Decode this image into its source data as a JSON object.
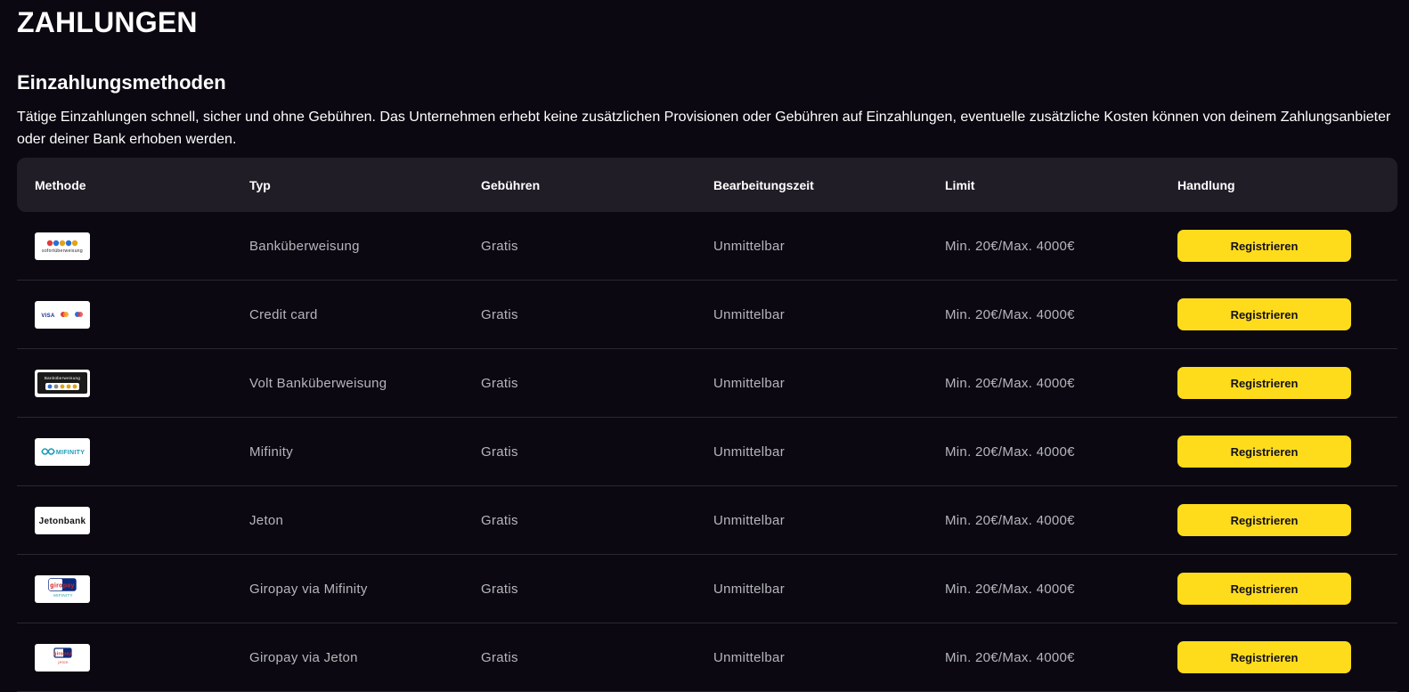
{
  "page": {
    "title": "ZAHLUNGEN",
    "section_title": "Einzahlungsmethoden",
    "intro": "Tätige Einzahlungen schnell, sicher und ohne Gebühren. Das Unternehmen erhebt keine zusätzlichen Provisionen oder Gebühren auf Einzahlungen, eventuelle zusätzliche Kosten können von deinem Zahlungsanbieter oder deiner Bank erhoben werden."
  },
  "table": {
    "headers": [
      "Methode",
      "Typ",
      "Gebühren",
      "Bearbeitungszeit",
      "Limit",
      "Handlung"
    ],
    "rows": [
      {
        "logo": "sofortueberweisung-logo",
        "logo_text": "sofortüberweisung",
        "type": "Banküberweisung",
        "fee": "Gratis",
        "time": "Unmittelbar",
        "limit": "Min. 20€/Max. 4000€",
        "action": "Registrieren"
      },
      {
        "logo": "credit-card-logos",
        "logo_text": "VISA",
        "type": "Credit card",
        "fee": "Gratis",
        "time": "Unmittelbar",
        "limit": "Min. 20€/Max. 4000€",
        "action": "Registrieren"
      },
      {
        "logo": "volt-logo",
        "logo_text": "Banküberweisung",
        "type": "Volt Banküberweisung",
        "fee": "Gratis",
        "time": "Unmittelbar",
        "limit": "Min. 20€/Max. 4000€",
        "action": "Registrieren"
      },
      {
        "logo": "mifinity-logo",
        "logo_text": "MIFINITY",
        "type": "Mifinity",
        "fee": "Gratis",
        "time": "Unmittelbar",
        "limit": "Min. 20€/Max. 4000€",
        "action": "Registrieren"
      },
      {
        "logo": "jetonbank-logo",
        "logo_text": "Jetonbank",
        "type": "Jeton",
        "fee": "Gratis",
        "time": "Unmittelbar",
        "limit": "Min. 20€/Max. 4000€",
        "action": "Registrieren"
      },
      {
        "logo": "giropay-mifinity-logo",
        "logo_text": "giropay",
        "logo_subtext": "MIFINITY",
        "type": "Giropay via Mifinity",
        "fee": "Gratis",
        "time": "Unmittelbar",
        "limit": "Min. 20€/Max. 4000€",
        "action": "Registrieren"
      },
      {
        "logo": "giropay-jeton-logo",
        "logo_text": "giropay",
        "logo_subtext": "jeton",
        "type": "Giropay via Jeton",
        "fee": "Gratis",
        "time": "Unmittelbar",
        "limit": "Min. 20€/Max. 4000€",
        "action": "Registrieren"
      }
    ]
  },
  "colors": {
    "background": "#0b0811",
    "header_bg": "#201d27",
    "accent": "#fedc1c",
    "muted_text": "#b7b5bc"
  }
}
